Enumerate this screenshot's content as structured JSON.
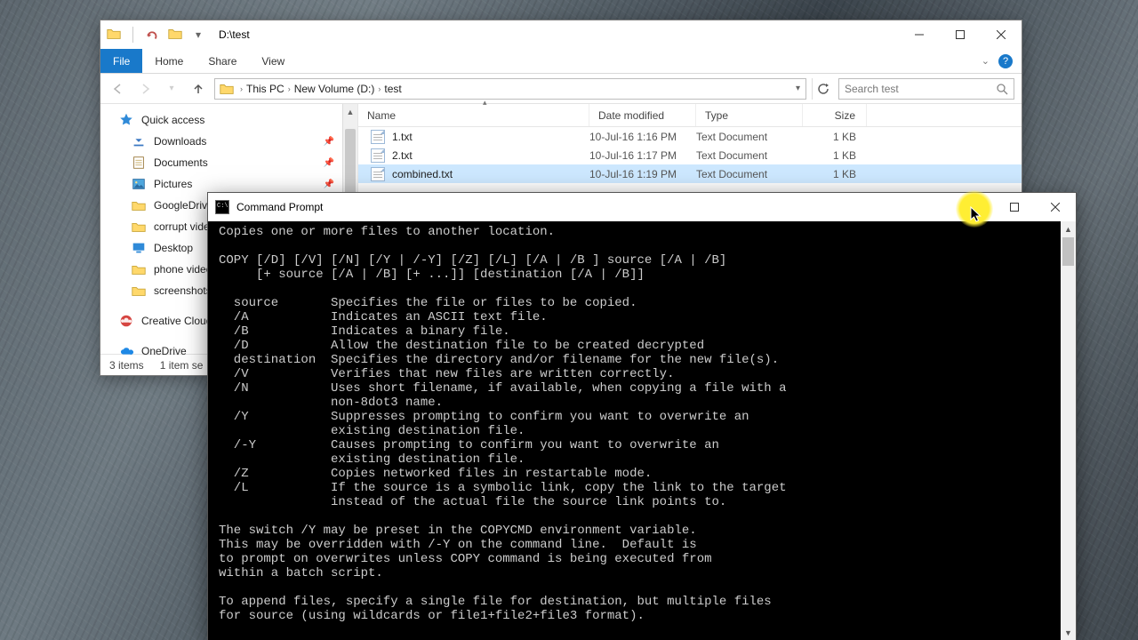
{
  "explorer": {
    "title": "D:\\test",
    "ribbon": {
      "file": "File",
      "home": "Home",
      "share": "Share",
      "view": "View"
    },
    "help_tooltip": "?",
    "breadcrumbs": [
      "This PC",
      "New Volume (D:)",
      "test"
    ],
    "refresh_label": "Refresh",
    "search_placeholder": "Search test",
    "nav": {
      "quick_access": "Quick access",
      "items": [
        {
          "label": "Downloads",
          "pinned": true
        },
        {
          "label": "Documents",
          "pinned": true
        },
        {
          "label": "Pictures",
          "pinned": true
        },
        {
          "label": "GoogleDrive",
          "pinned": true
        },
        {
          "label": "corrupt videos",
          "pinned": true
        },
        {
          "label": "Desktop",
          "pinned": false
        },
        {
          "label": "phone videos",
          "pinned": false
        },
        {
          "label": "screenshots",
          "pinned": false
        }
      ],
      "creative_cloud": "Creative Cloud",
      "onedrive": "OneDrive"
    },
    "columns": {
      "name": "Name",
      "date": "Date modified",
      "type": "Type",
      "size": "Size"
    },
    "files": [
      {
        "name": "1.txt",
        "date": "10-Jul-16 1:16 PM",
        "type": "Text Document",
        "size": "1 KB",
        "selected": false
      },
      {
        "name": "2.txt",
        "date": "10-Jul-16 1:17 PM",
        "type": "Text Document",
        "size": "1 KB",
        "selected": false
      },
      {
        "name": "combined.txt",
        "date": "10-Jul-16 1:19 PM",
        "type": "Text Document",
        "size": "1 KB",
        "selected": true
      }
    ],
    "status": {
      "count": "3 items",
      "selection": "1 item se"
    }
  },
  "cmd": {
    "title": "Command Prompt",
    "text": "Copies one or more files to another location.\n\nCOPY [/D] [/V] [/N] [/Y | /-Y] [/Z] [/L] [/A | /B ] source [/A | /B]\n     [+ source [/A | /B] [+ ...]] [destination [/A | /B]]\n\n  source       Specifies the file or files to be copied.\n  /A           Indicates an ASCII text file.\n  /B           Indicates a binary file.\n  /D           Allow the destination file to be created decrypted\n  destination  Specifies the directory and/or filename for the new file(s).\n  /V           Verifies that new files are written correctly.\n  /N           Uses short filename, if available, when copying a file with a\n               non-8dot3 name.\n  /Y           Suppresses prompting to confirm you want to overwrite an\n               existing destination file.\n  /-Y          Causes prompting to confirm you want to overwrite an\n               existing destination file.\n  /Z           Copies networked files in restartable mode.\n  /L           If the source is a symbolic link, copy the link to the target\n               instead of the actual file the source link points to.\n\nThe switch /Y may be preset in the COPYCMD environment variable.\nThis may be overridden with /-Y on the command line.  Default is\nto prompt on overwrites unless COPY command is being executed from\nwithin a batch script.\n\nTo append files, specify a single file for destination, but multiple files\nfor source (using wildcards or file1+file2+file3 format).\n"
  }
}
